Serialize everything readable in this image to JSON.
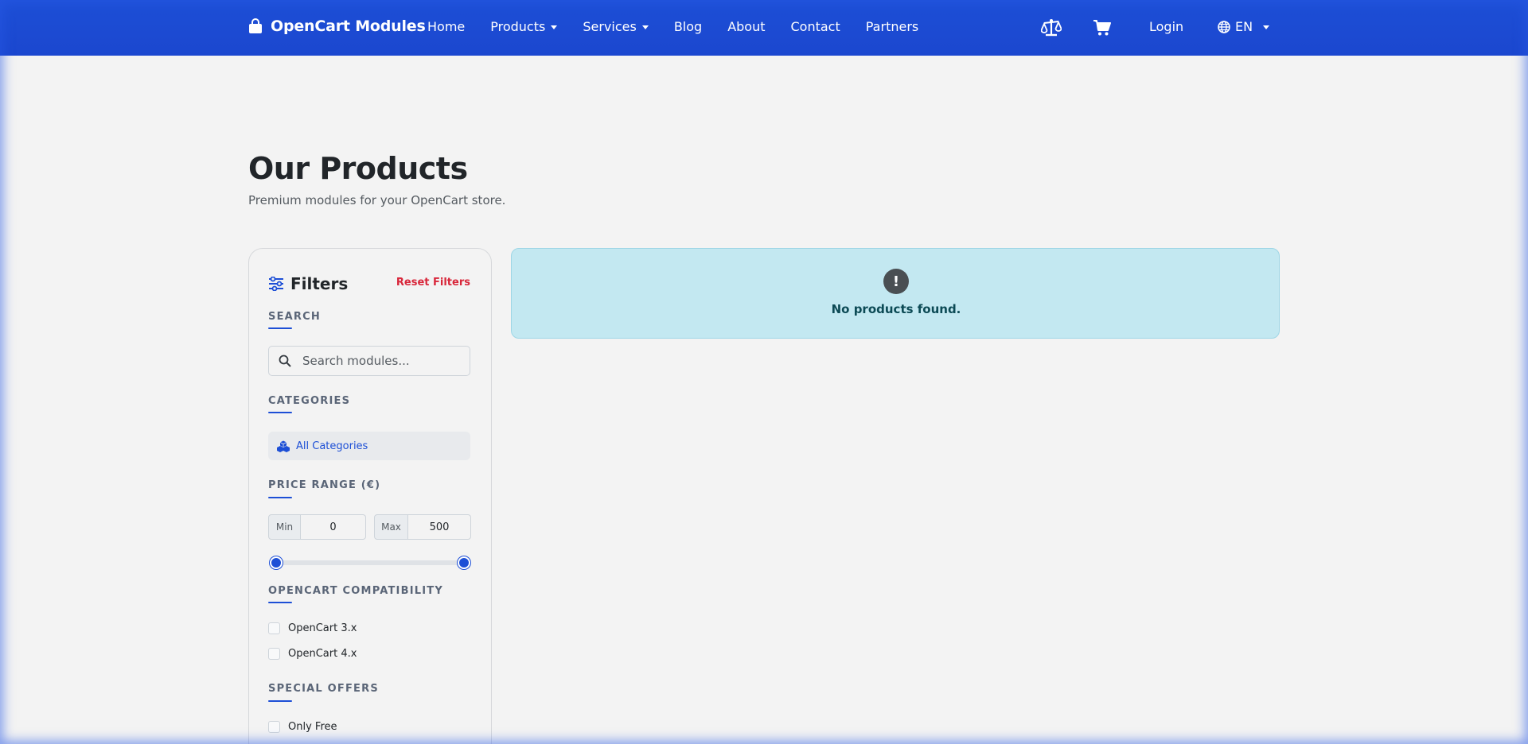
{
  "navbar": {
    "brand": "OpenCart Modules",
    "links": [
      {
        "label": "Home",
        "dropdown": false
      },
      {
        "label": "Products",
        "dropdown": true
      },
      {
        "label": "Services",
        "dropdown": true
      },
      {
        "label": "Blog",
        "dropdown": false
      },
      {
        "label": "About",
        "dropdown": false
      },
      {
        "label": "Contact",
        "dropdown": false
      },
      {
        "label": "Partners",
        "dropdown": false
      }
    ],
    "login": "Login",
    "language": "EN"
  },
  "header": {
    "title": "Our Products",
    "subtitle": "Premium modules for your OpenCart store."
  },
  "filters": {
    "title": "Filters",
    "reset_label": "Reset Filters",
    "search": {
      "label": "SEARCH",
      "placeholder": "Search modules...",
      "value": ""
    },
    "categories": {
      "label": "CATEGORIES",
      "items": [
        "All Categories"
      ]
    },
    "price": {
      "label": "PRICE RANGE (€)",
      "min_label": "Min",
      "min_value": "0",
      "max_label": "Max",
      "max_value": "500"
    },
    "compatibility": {
      "label": "OPENCART COMPATIBILITY",
      "options": [
        "OpenCart 3.x",
        "OpenCart 4.x"
      ]
    },
    "special_offers": {
      "label": "SPECIAL OFFERS",
      "options": [
        "Only Free"
      ]
    }
  },
  "results": {
    "empty_message": "No products found.",
    "icon": "exclamation-circle-icon"
  },
  "colors": {
    "primary": "#1d4fd6",
    "danger": "#d8263a",
    "alert_bg": "#c3e8f1",
    "alert_text": "#0c4a55"
  }
}
